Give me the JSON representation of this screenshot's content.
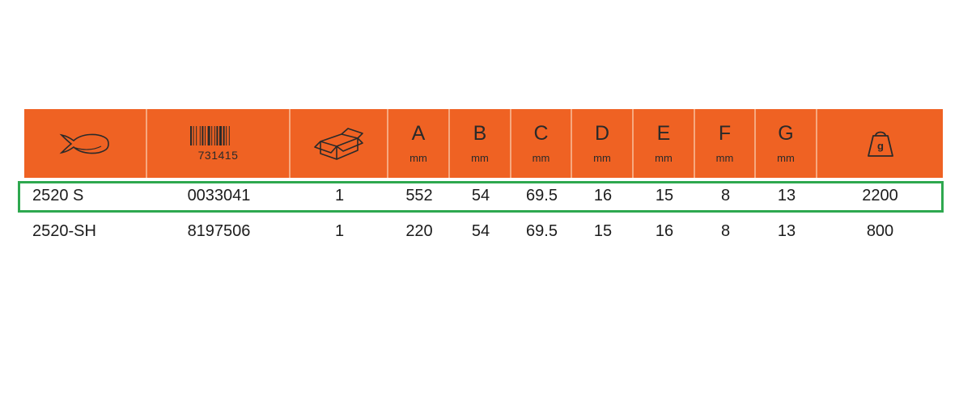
{
  "header": {
    "tool_icon": "fish-shaped-tool-icon",
    "barcode_icon": "barcode-icon",
    "ean_code": "731415",
    "package_icon": "open-box-icon",
    "weight_icon": "weight-icon",
    "weight_unit": "g",
    "dimensions": [
      {
        "letter": "A",
        "unit": "mm"
      },
      {
        "letter": "B",
        "unit": "mm"
      },
      {
        "letter": "C",
        "unit": "mm"
      },
      {
        "letter": "D",
        "unit": "mm"
      },
      {
        "letter": "E",
        "unit": "mm"
      },
      {
        "letter": "F",
        "unit": "mm"
      },
      {
        "letter": "G",
        "unit": "mm"
      }
    ]
  },
  "rows": [
    {
      "cells": [
        "2520 S",
        "0033041",
        "1",
        "552",
        "54",
        "69.5",
        "16",
        "15",
        "8",
        "13",
        "2200"
      ],
      "highlighted": true
    },
    {
      "cells": [
        "2520-SH",
        "8197506",
        "1",
        "220",
        "54",
        "69.5",
        "15",
        "16",
        "8",
        "13",
        "800"
      ],
      "highlighted": false
    }
  ],
  "colors": {
    "header_bg": "#ef6223",
    "highlight_border": "#2ea84f"
  }
}
